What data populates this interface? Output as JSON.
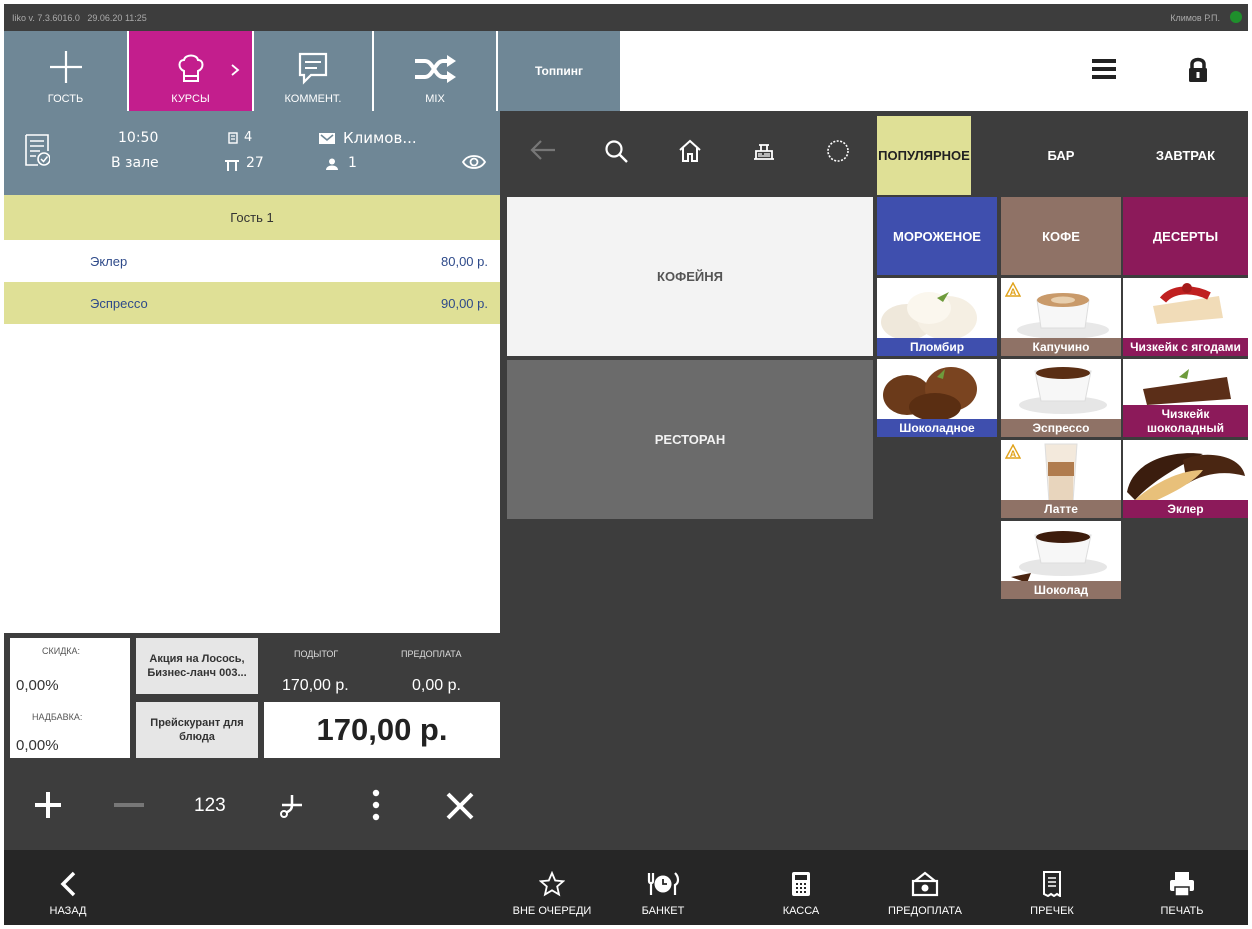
{
  "status": {
    "version": "Iiko v. 7.3.6016.0",
    "datetime": "29.06.20  11:25",
    "user": "Климов Р.П."
  },
  "toolbar": {
    "guest": "ГОСТЬ",
    "courses": "КУРСЫ",
    "comment": "КОММЕНТ.",
    "mix": "MIX",
    "topping": "Топпинг"
  },
  "order": {
    "time": "10:50",
    "location": "В зале",
    "guests_count": "4",
    "table": "27",
    "waiter": "Климов...",
    "persons": "1",
    "guest_label": "Гость 1",
    "items": [
      {
        "name": "Эклер",
        "price": "80,00 р."
      },
      {
        "name": "Эспрессо",
        "price": "90,00 р."
      }
    ]
  },
  "totals": {
    "discount_label": "СКИДКА:",
    "discount": "0,00%",
    "markup_label": "НАДБАВКА:",
    "markup": "0,00%",
    "promo": "Акция на Лосось, Бизнес-ланч 003...",
    "pricelist": "Прейскурант для блюда",
    "subtotal_label": "ПОДЫТОГ",
    "subtotal": "170,00 р.",
    "prepay_label": "ПРЕДОПЛАТА",
    "prepay": "0,00 р.",
    "total": "170,00 р."
  },
  "actions": {
    "qty": "123"
  },
  "categories": {
    "popular": "ПОПУЛЯРНОЕ",
    "bar": "БАР",
    "breakfast": "ЗАВТРАК",
    "icecream": "МОРОЖЕНОЕ",
    "coffee": "КОФЕ",
    "desserts": "ДЕСЕРТЫ"
  },
  "sections": {
    "coffee_shop": "КОФЕЙНЯ",
    "restaurant": "РЕСТОРАН"
  },
  "products": {
    "plombir": "Пломбир",
    "chocolate_ice": "Шоколадное",
    "cappuccino": "Капучино",
    "espresso": "Эспрессо",
    "latte": "Латте",
    "chocolate": "Шоколад",
    "cheesecake_berries": "Чизкейк с ягодами",
    "cheesecake_choc": "Чизкейк шоколадный",
    "eclair": "Эклер"
  },
  "bottom": {
    "back": "НАЗАД",
    "out_of_queue": "ВНЕ ОЧЕРЕДИ",
    "banquet": "БАНКЕТ",
    "cash": "КАССА",
    "prepay": "ПРЕДОПЛАТА",
    "precheck": "ПРЕЧЕК",
    "print": "ПЕЧАТЬ"
  },
  "colors": {
    "courses_active": "#c31e8d",
    "toolbar": "#6f8796",
    "highlight": "#dfe096",
    "icecream": "#3f4fae",
    "coffee": "#8f7266",
    "desserts": "#8c1a5a"
  }
}
